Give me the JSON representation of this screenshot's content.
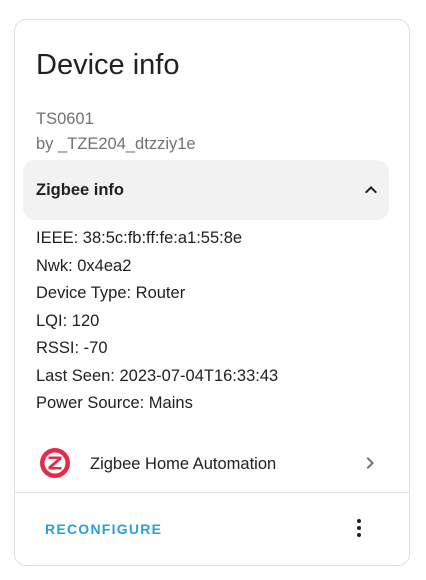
{
  "card": {
    "title": "Device info",
    "model": "TS0601",
    "manufacturer": "by _TZE204_dtzziy1e"
  },
  "zigbee_info": {
    "header": "Zigbee info",
    "expanded": true,
    "rows": [
      "IEEE: 38:5c:fb:ff:fe:a1:55:8e",
      "Nwk: 0x4ea2",
      "Device Type: Router",
      "LQI: 120",
      "RSSI: -70",
      "Last Seen: 2023-07-04T16:33:43",
      "Power Source: Mains"
    ]
  },
  "integration": {
    "label": "Zigbee Home Automation",
    "logo_icon": "zha-logo-icon",
    "logo_color": "#e62b4a"
  },
  "actions": {
    "reconfigure_label": "RECONFIGURE",
    "more_icon": "dots-vertical-icon",
    "accent_color": "#2a9fd8"
  }
}
